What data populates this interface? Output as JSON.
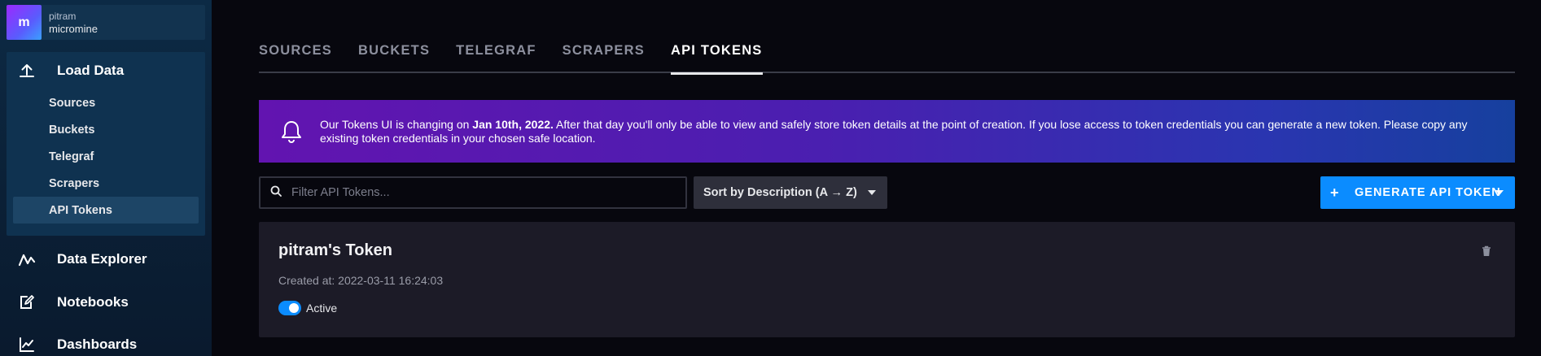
{
  "org": {
    "avatar_letter": "m",
    "user": "pitram",
    "name": "micromine"
  },
  "sidebar": {
    "load_data": {
      "label": "Load Data",
      "icon": "upload-icon",
      "items": [
        {
          "label": "Sources",
          "active": false
        },
        {
          "label": "Buckets",
          "active": false
        },
        {
          "label": "Telegraf",
          "active": false
        },
        {
          "label": "Scrapers",
          "active": false
        },
        {
          "label": "API Tokens",
          "active": true
        }
      ]
    },
    "data_explorer": {
      "label": "Data Explorer",
      "icon": "graph-icon"
    },
    "notebooks": {
      "label": "Notebooks",
      "icon": "notebook-icon"
    },
    "dashboards": {
      "label": "Dashboards",
      "icon": "chart-icon"
    }
  },
  "tabs": [
    {
      "label": "SOURCES",
      "active": false
    },
    {
      "label": "BUCKETS",
      "active": false
    },
    {
      "label": "TELEGRAF",
      "active": false
    },
    {
      "label": "SCRAPERS",
      "active": false
    },
    {
      "label": "API TOKENS",
      "active": true
    }
  ],
  "banner": {
    "icon": "bell-icon",
    "text_before": "Our Tokens UI is changing on ",
    "date": "Jan 10th, 2022.",
    "text_after": " After that day you'll only be able to view and safely store token details at the point of creation. If you lose access to token credentials you can generate a new token. Please copy any existing token credentials in your chosen safe location."
  },
  "controls": {
    "search_placeholder": "Filter API Tokens...",
    "search_value": "",
    "sort_label": "Sort by Description (A → Z)",
    "generate_label": "GENERATE API TOKEN"
  },
  "tokens": [
    {
      "name": "pitram's Token",
      "created": "Created at: 2022-03-11 16:24:03",
      "status": "Active",
      "active": true
    }
  ],
  "colors": {
    "accent": "#0b8cff",
    "banner_start": "#6214b0",
    "banner_end": "#16409e",
    "sidebar": "#0c2a45"
  }
}
